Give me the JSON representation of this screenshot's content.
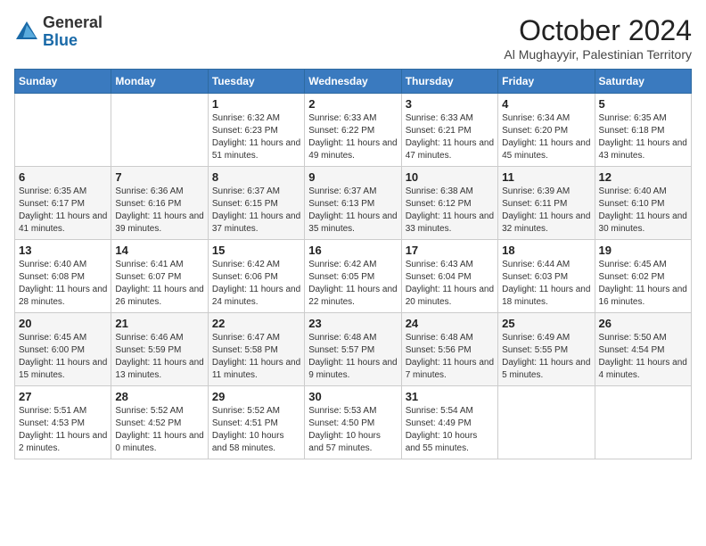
{
  "logo": {
    "general": "General",
    "blue": "Blue"
  },
  "title": "October 2024",
  "subtitle": "Al Mughayyir, Palestinian Territory",
  "headers": [
    "Sunday",
    "Monday",
    "Tuesday",
    "Wednesday",
    "Thursday",
    "Friday",
    "Saturday"
  ],
  "weeks": [
    [
      {
        "day": "",
        "detail": ""
      },
      {
        "day": "",
        "detail": ""
      },
      {
        "day": "1",
        "detail": "Sunrise: 6:32 AM\nSunset: 6:23 PM\nDaylight: 11 hours and 51 minutes."
      },
      {
        "day": "2",
        "detail": "Sunrise: 6:33 AM\nSunset: 6:22 PM\nDaylight: 11 hours and 49 minutes."
      },
      {
        "day": "3",
        "detail": "Sunrise: 6:33 AM\nSunset: 6:21 PM\nDaylight: 11 hours and 47 minutes."
      },
      {
        "day": "4",
        "detail": "Sunrise: 6:34 AM\nSunset: 6:20 PM\nDaylight: 11 hours and 45 minutes."
      },
      {
        "day": "5",
        "detail": "Sunrise: 6:35 AM\nSunset: 6:18 PM\nDaylight: 11 hours and 43 minutes."
      }
    ],
    [
      {
        "day": "6",
        "detail": "Sunrise: 6:35 AM\nSunset: 6:17 PM\nDaylight: 11 hours and 41 minutes."
      },
      {
        "day": "7",
        "detail": "Sunrise: 6:36 AM\nSunset: 6:16 PM\nDaylight: 11 hours and 39 minutes."
      },
      {
        "day": "8",
        "detail": "Sunrise: 6:37 AM\nSunset: 6:15 PM\nDaylight: 11 hours and 37 minutes."
      },
      {
        "day": "9",
        "detail": "Sunrise: 6:37 AM\nSunset: 6:13 PM\nDaylight: 11 hours and 35 minutes."
      },
      {
        "day": "10",
        "detail": "Sunrise: 6:38 AM\nSunset: 6:12 PM\nDaylight: 11 hours and 33 minutes."
      },
      {
        "day": "11",
        "detail": "Sunrise: 6:39 AM\nSunset: 6:11 PM\nDaylight: 11 hours and 32 minutes."
      },
      {
        "day": "12",
        "detail": "Sunrise: 6:40 AM\nSunset: 6:10 PM\nDaylight: 11 hours and 30 minutes."
      }
    ],
    [
      {
        "day": "13",
        "detail": "Sunrise: 6:40 AM\nSunset: 6:08 PM\nDaylight: 11 hours and 28 minutes."
      },
      {
        "day": "14",
        "detail": "Sunrise: 6:41 AM\nSunset: 6:07 PM\nDaylight: 11 hours and 26 minutes."
      },
      {
        "day": "15",
        "detail": "Sunrise: 6:42 AM\nSunset: 6:06 PM\nDaylight: 11 hours and 24 minutes."
      },
      {
        "day": "16",
        "detail": "Sunrise: 6:42 AM\nSunset: 6:05 PM\nDaylight: 11 hours and 22 minutes."
      },
      {
        "day": "17",
        "detail": "Sunrise: 6:43 AM\nSunset: 6:04 PM\nDaylight: 11 hours and 20 minutes."
      },
      {
        "day": "18",
        "detail": "Sunrise: 6:44 AM\nSunset: 6:03 PM\nDaylight: 11 hours and 18 minutes."
      },
      {
        "day": "19",
        "detail": "Sunrise: 6:45 AM\nSunset: 6:02 PM\nDaylight: 11 hours and 16 minutes."
      }
    ],
    [
      {
        "day": "20",
        "detail": "Sunrise: 6:45 AM\nSunset: 6:00 PM\nDaylight: 11 hours and 15 minutes."
      },
      {
        "day": "21",
        "detail": "Sunrise: 6:46 AM\nSunset: 5:59 PM\nDaylight: 11 hours and 13 minutes."
      },
      {
        "day": "22",
        "detail": "Sunrise: 6:47 AM\nSunset: 5:58 PM\nDaylight: 11 hours and 11 minutes."
      },
      {
        "day": "23",
        "detail": "Sunrise: 6:48 AM\nSunset: 5:57 PM\nDaylight: 11 hours and 9 minutes."
      },
      {
        "day": "24",
        "detail": "Sunrise: 6:48 AM\nSunset: 5:56 PM\nDaylight: 11 hours and 7 minutes."
      },
      {
        "day": "25",
        "detail": "Sunrise: 6:49 AM\nSunset: 5:55 PM\nDaylight: 11 hours and 5 minutes."
      },
      {
        "day": "26",
        "detail": "Sunrise: 5:50 AM\nSunset: 4:54 PM\nDaylight: 11 hours and 4 minutes."
      }
    ],
    [
      {
        "day": "27",
        "detail": "Sunrise: 5:51 AM\nSunset: 4:53 PM\nDaylight: 11 hours and 2 minutes."
      },
      {
        "day": "28",
        "detail": "Sunrise: 5:52 AM\nSunset: 4:52 PM\nDaylight: 11 hours and 0 minutes."
      },
      {
        "day": "29",
        "detail": "Sunrise: 5:52 AM\nSunset: 4:51 PM\nDaylight: 10 hours and 58 minutes."
      },
      {
        "day": "30",
        "detail": "Sunrise: 5:53 AM\nSunset: 4:50 PM\nDaylight: 10 hours and 57 minutes."
      },
      {
        "day": "31",
        "detail": "Sunrise: 5:54 AM\nSunset: 4:49 PM\nDaylight: 10 hours and 55 minutes."
      },
      {
        "day": "",
        "detail": ""
      },
      {
        "day": "",
        "detail": ""
      }
    ]
  ]
}
